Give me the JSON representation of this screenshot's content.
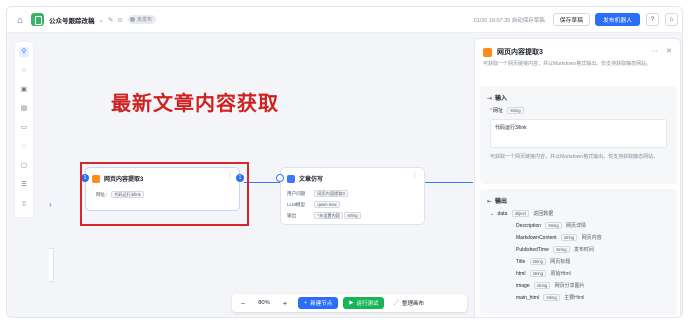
{
  "app": {
    "title": "公众号跟踪改稿",
    "publish_status": "未发布"
  },
  "topbar": {
    "save_status": "01/20 16:07:35 自动保存草稿",
    "save_label": "保存草稿",
    "publish_label": "发布机器人"
  },
  "canvas": {
    "annotation": "最新文章内容获取",
    "zoom": "80%",
    "add_node_label": "新建节点",
    "run_test_label": "运行测试",
    "arrange_label": "整理画布"
  },
  "nodes": {
    "fetch": {
      "title": "网页内容提取3",
      "field_label": "网址：",
      "field_value": "代码运行3/link",
      "port_in": "1",
      "port_out": "1"
    },
    "write": {
      "title": "文章仿写",
      "rows": [
        {
          "label": "用户问题",
          "value": "网页内容提取3"
        },
        {
          "label": "LLM模型",
          "value": "qwen-max"
        },
        {
          "label": "输出",
          "value": "*未设置内容",
          "type": "string"
        }
      ]
    }
  },
  "panel": {
    "title": "网页内容提取3",
    "description": "可获取一个网页链接内容，并以Markdown格式输出。仅支持获取静态网站。",
    "input_title": "输入",
    "input_field_label": "网址",
    "input_field_type": "string",
    "input_value": "代码运行3/link",
    "input_help": "可获取一个网页链接内容，并以Markdown格式输出。仅支持获取静态网站。",
    "output_title": "输出",
    "output_root": {
      "name": "data",
      "type": "object",
      "desc": "返回数据"
    },
    "output_fields": [
      {
        "name": "Description",
        "type": "string",
        "desc": "网页详情"
      },
      {
        "name": "MarkdownContent",
        "type": "string",
        "desc": "网页内容"
      },
      {
        "name": "PublishedTime",
        "type": "string",
        "desc": "发布时间"
      },
      {
        "name": "Title",
        "type": "string",
        "desc": "网页标题"
      },
      {
        "name": "html",
        "type": "string",
        "desc": "原始Html"
      },
      {
        "name": "image",
        "type": "string",
        "desc": "网页分享图片"
      },
      {
        "name": "main_html",
        "type": "string",
        "desc": "主要Html"
      }
    ]
  },
  "colors": {
    "accent": "#2b6df6",
    "annotation_red": "#d02020",
    "run_green": "#18b45a",
    "node_icon_orange": "#ff8c1a"
  }
}
